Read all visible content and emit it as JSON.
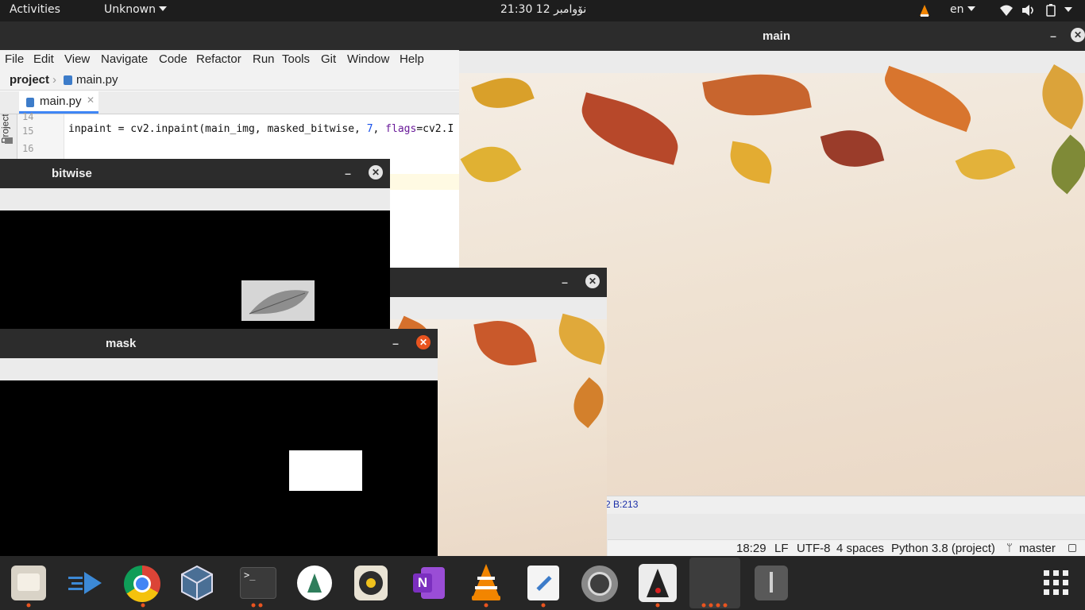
{
  "topbar": {
    "activities": "Activities",
    "app_menu": "Unknown",
    "clock": "21:30  12 نۆوامبر",
    "lang": "en"
  },
  "ide": {
    "menu": [
      "File",
      "Edit",
      "View",
      "Navigate",
      "Code",
      "Refactor",
      "Run",
      "Tools",
      "Git",
      "Window",
      "Help"
    ],
    "breadcrumb": {
      "project": "project",
      "file": "main.py"
    },
    "tab_label": "main.py",
    "side_label": "Project",
    "lines": [
      {
        "no": "14",
        "code": ""
      },
      {
        "no": "15",
        "code": "inpaint = cv2.inpaint(main_img, masked_bitwise, 7, flags=cv2.I"
      },
      {
        "no": "16",
        "code": ""
      }
    ],
    "code_parts": {
      "a": "inpaint = cv2.inpaint(main_img, masked_bitwise, ",
      "b": "7",
      "c": ", ",
      "d": "flags",
      "e": "=cv2.I"
    }
  },
  "windows": {
    "main": {
      "title": "main",
      "pixel_info": "2 B:213"
    },
    "bitwise": {
      "title": "bitwise"
    },
    "inpaint": {
      "title": ""
    },
    "mask": {
      "title": "mask"
    }
  },
  "status": {
    "position": "18:29",
    "line_sep": "LF",
    "encoding": "UTF-8",
    "indent": "4 spaces",
    "interpreter": "Python 3.8 (project)",
    "branch": "master"
  },
  "dock": {
    "apps": [
      "files-icon",
      "kdenlive-icon",
      "chrome-icon",
      "virtualbox-icon",
      "terminal-icon",
      "android-studio-icon",
      "rhythmbox-icon",
      "onenote-icon",
      "vlc-icon",
      "text-editor-icon",
      "settings-icon",
      "java-icon",
      "active-windows-icon",
      "usb-drive-icon"
    ],
    "show_apps": "show-apps-icon"
  },
  "colors": {
    "accent": "#3f86f5",
    "close_active": "#e9541f",
    "vlc_orange": "#f28500"
  }
}
